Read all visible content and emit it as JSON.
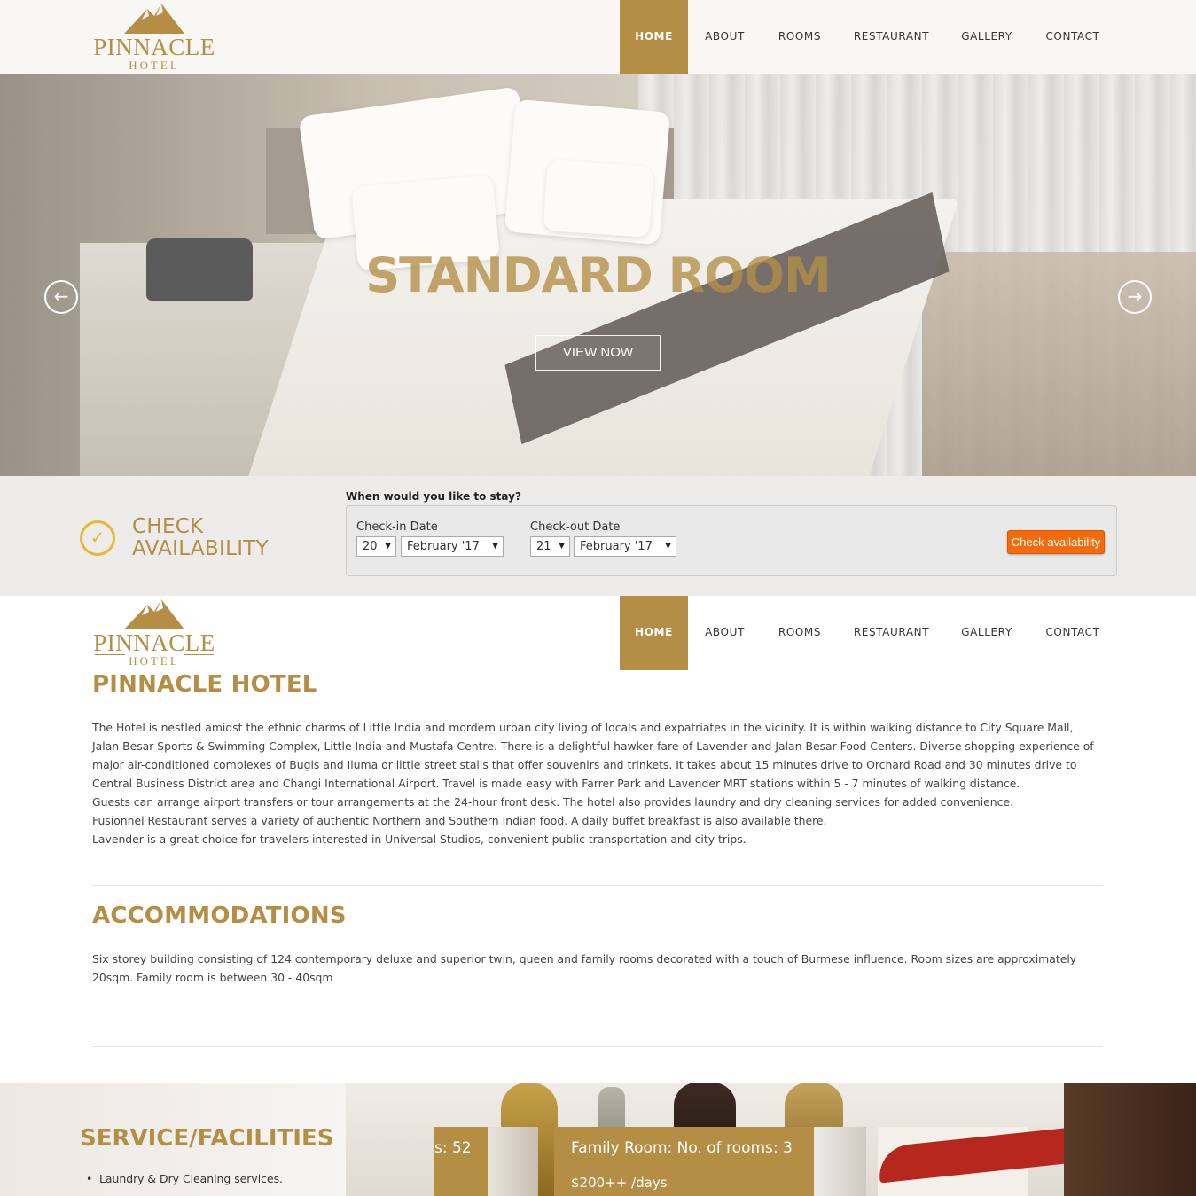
{
  "brand": {
    "name": "PINNACLE",
    "sub": "HOTEL"
  },
  "nav": [
    "HOME",
    "ABOUT",
    "ROOMS",
    "RESTAURANT",
    "GALLERY",
    "CONTACT"
  ],
  "hero": {
    "title": "STANDARD ROOM",
    "button": "VIEW NOW",
    "prev_icon": "arrow-left-icon",
    "next_icon": "arrow-right-icon"
  },
  "availability": {
    "title_line1": "CHECK",
    "title_line2": "AVAILABILITY",
    "question": "When would you like to stay?",
    "checkin_label": "Check-in Date",
    "checkin_day": "20",
    "checkin_month": "February '17",
    "checkout_label": "Check-out Date",
    "checkout_day": "21",
    "checkout_month": "February '17",
    "button": "Check availability"
  },
  "about": {
    "title": "PINNACLE HOTEL",
    "lines": [
      "The Hotel is nestled amidst the ethnic charms of Little India and mordern urban city living of locals and expatriates in the vicinity. It is within walking distance to City Square Mall,",
      "Jalan Besar Sports & Swimming Complex, Little India and Mustafa Centre. There is a delightful hawker fare of Lavender and Jalan Besar Food Centers. Diverse shopping experience of",
      "major air-conditioned complexes of Bugis and Iluma or little street stalls that offer souvenirs and trinkets. It takes about 15 minutes drive to Orchard Road and 30 minutes drive to",
      "Central Business District area and Changi International Airport. Travel is made easy with Farrer Park and Lavender MRT stations within 5 - 7 minutes of walking distance.",
      "Guests can arrange airport transfers or tour arrangements at the 24-hour front desk. The hotel also provides laundry and dry cleaning services for added convenience.",
      "Fusionnel Restaurant serves a variety of authentic Northern and Southern Indian food. A daily buffet breakfast is also available there.",
      "Lavender is a great choice for travelers interested in Universal Studios, convenient public transportation and city trips."
    ]
  },
  "accommodations": {
    "title": "ACCOMMODATIONS",
    "lines": [
      "Six storey building consisting of 124 contemporary deluxe and superior twin, queen and family rooms decorated with a touch of Burmese influence. Room sizes are approximately",
      "20sqm. Family room is between 30 - 40sqm"
    ]
  },
  "services": {
    "title": "SERVICE/FACILITIES",
    "items": [
      "Laundry & Dry Cleaning services."
    ]
  },
  "room_cards": [
    {
      "title": "s: 52",
      "price": ""
    },
    {
      "title": "Family Room: No. of rooms: 3",
      "price": "$200++ /days"
    }
  ],
  "colors": {
    "gold": "#b48e45",
    "orange": "#f26c0d",
    "check_icon": "#e5b934"
  }
}
